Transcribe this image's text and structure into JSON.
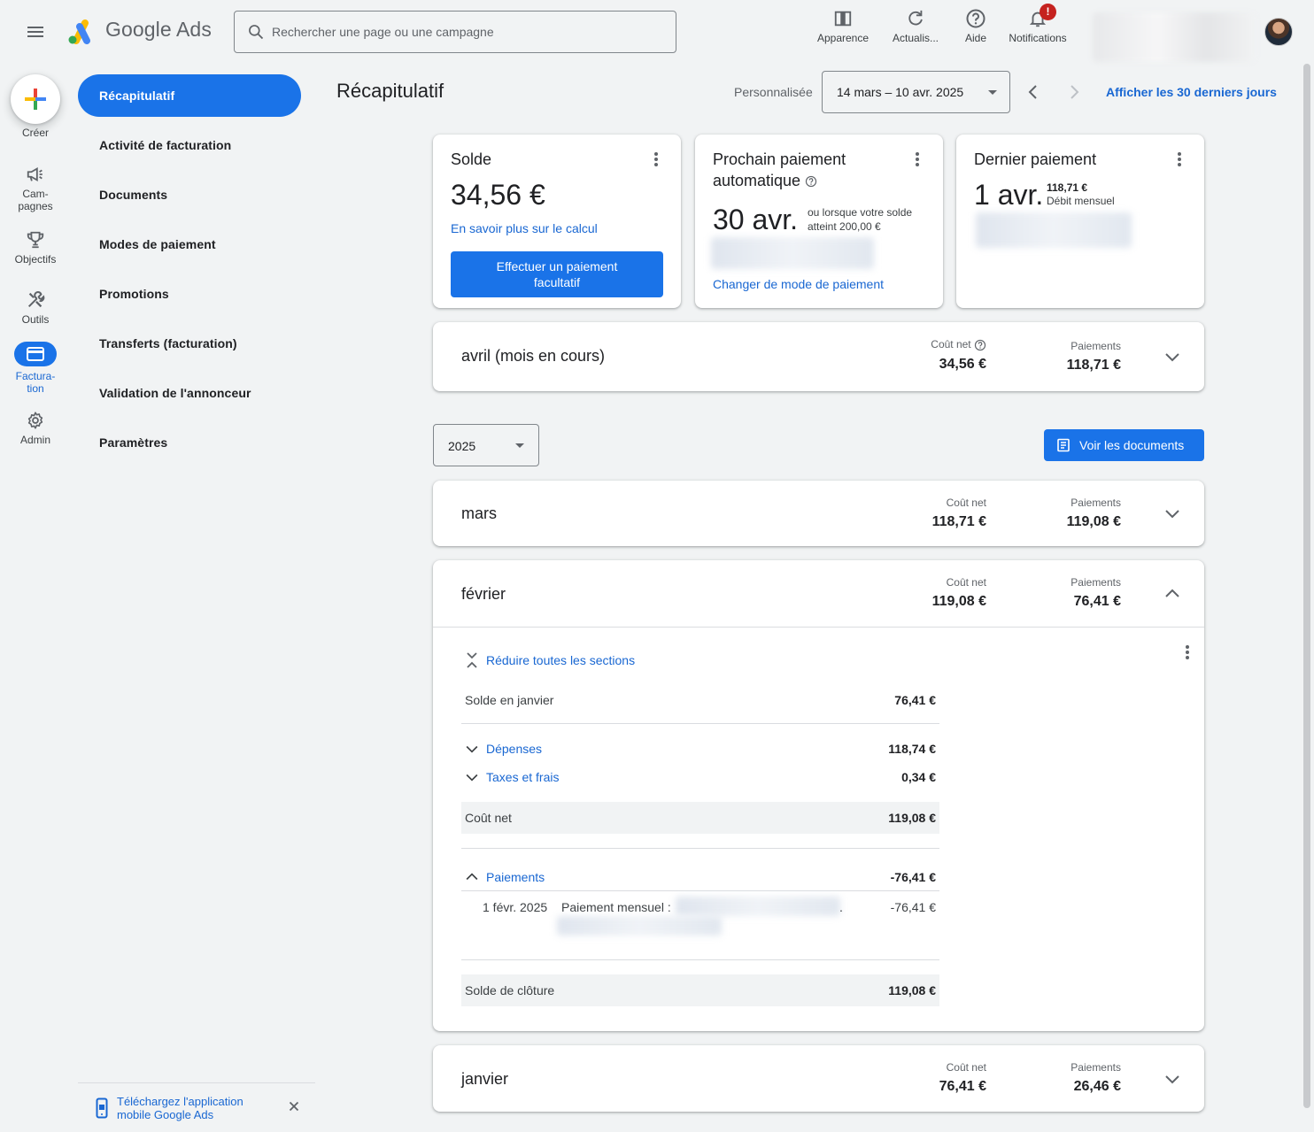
{
  "header": {
    "product_name": "Google Ads",
    "search_placeholder": "Rechercher une page ou une campagne",
    "buttons": {
      "appearance": "Apparence",
      "refresh": "Actualis...",
      "help": "Aide",
      "notifications": "Notifications"
    },
    "notification_badge": "!"
  },
  "rail": {
    "create": "Créer",
    "campaigns": "Cam-\npagnes",
    "goals": "Objectifs",
    "tools": "Outils",
    "billing": "Factura-\ntion",
    "admin": "Admin"
  },
  "sidenav": {
    "items": [
      "Récapitulatif",
      "Activité de facturation",
      "Documents",
      "Modes de paiement",
      "Promotions",
      "Transferts (facturation)",
      "Validation de l'annonceur",
      "Paramètres"
    ],
    "promo": "Téléchargez l'application mobile Google Ads"
  },
  "page": {
    "title": "Récapitulatif",
    "date_mode": "Personnalisée",
    "date_range": "14 mars – 10 avr. 2025",
    "last_30_link": "Afficher les 30 derniers jours"
  },
  "cards": {
    "balance": {
      "title": "Solde",
      "amount": "34,56 €",
      "link": "En savoir plus sur le calcul",
      "button": "Effectuer un paiement facultatif"
    },
    "next_payment": {
      "title": "Prochain paiement automatique",
      "date": "30 avr.",
      "note": "ou lorsque votre solde atteint 200,00 €",
      "link": "Changer de mode de paiement"
    },
    "last_payment": {
      "title": "Dernier paiement",
      "date": "1 avr.",
      "amount": "118,71 €",
      "type": "Débit mensuel"
    }
  },
  "current_month": {
    "name": "avril (mois en cours)",
    "net_cost_label": "Coût net",
    "net_cost": "34,56 €",
    "payments_label": "Paiements",
    "payments": "118,71 €"
  },
  "year": "2025",
  "docs_button": "Voir les documents",
  "months": [
    {
      "name": "mars",
      "net_cost_label": "Coût net",
      "net_cost": "118,71 €",
      "payments_label": "Paiements",
      "payments": "119,08 €"
    },
    {
      "name": "février",
      "net_cost_label": "Coût net",
      "net_cost": "119,08 €",
      "payments_label": "Paiements",
      "payments": "76,41 €"
    },
    {
      "name": "janvier",
      "net_cost_label": "Coût net",
      "net_cost": "76,41 €",
      "payments_label": "Paiements",
      "payments": "26,46 €"
    }
  ],
  "february_details": {
    "collapse_all": "Réduire toutes les sections",
    "opening_label": "Solde en janvier",
    "opening_value": "76,41 €",
    "spend_label": "Dépenses",
    "spend_value": "118,74 €",
    "taxes_label": "Taxes et frais",
    "taxes_value": "0,34 €",
    "net_label": "Coût net",
    "net_value": "119,08 €",
    "payments_label": "Paiements",
    "payments_value": "-76,41 €",
    "payment_date": "1 févr. 2025",
    "payment_link": "Paiement mensuel :",
    "payment_dot": ".",
    "payment_amount": "-76,41 €",
    "closing_label": "Solde de clôture",
    "closing_value": "119,08 €"
  }
}
